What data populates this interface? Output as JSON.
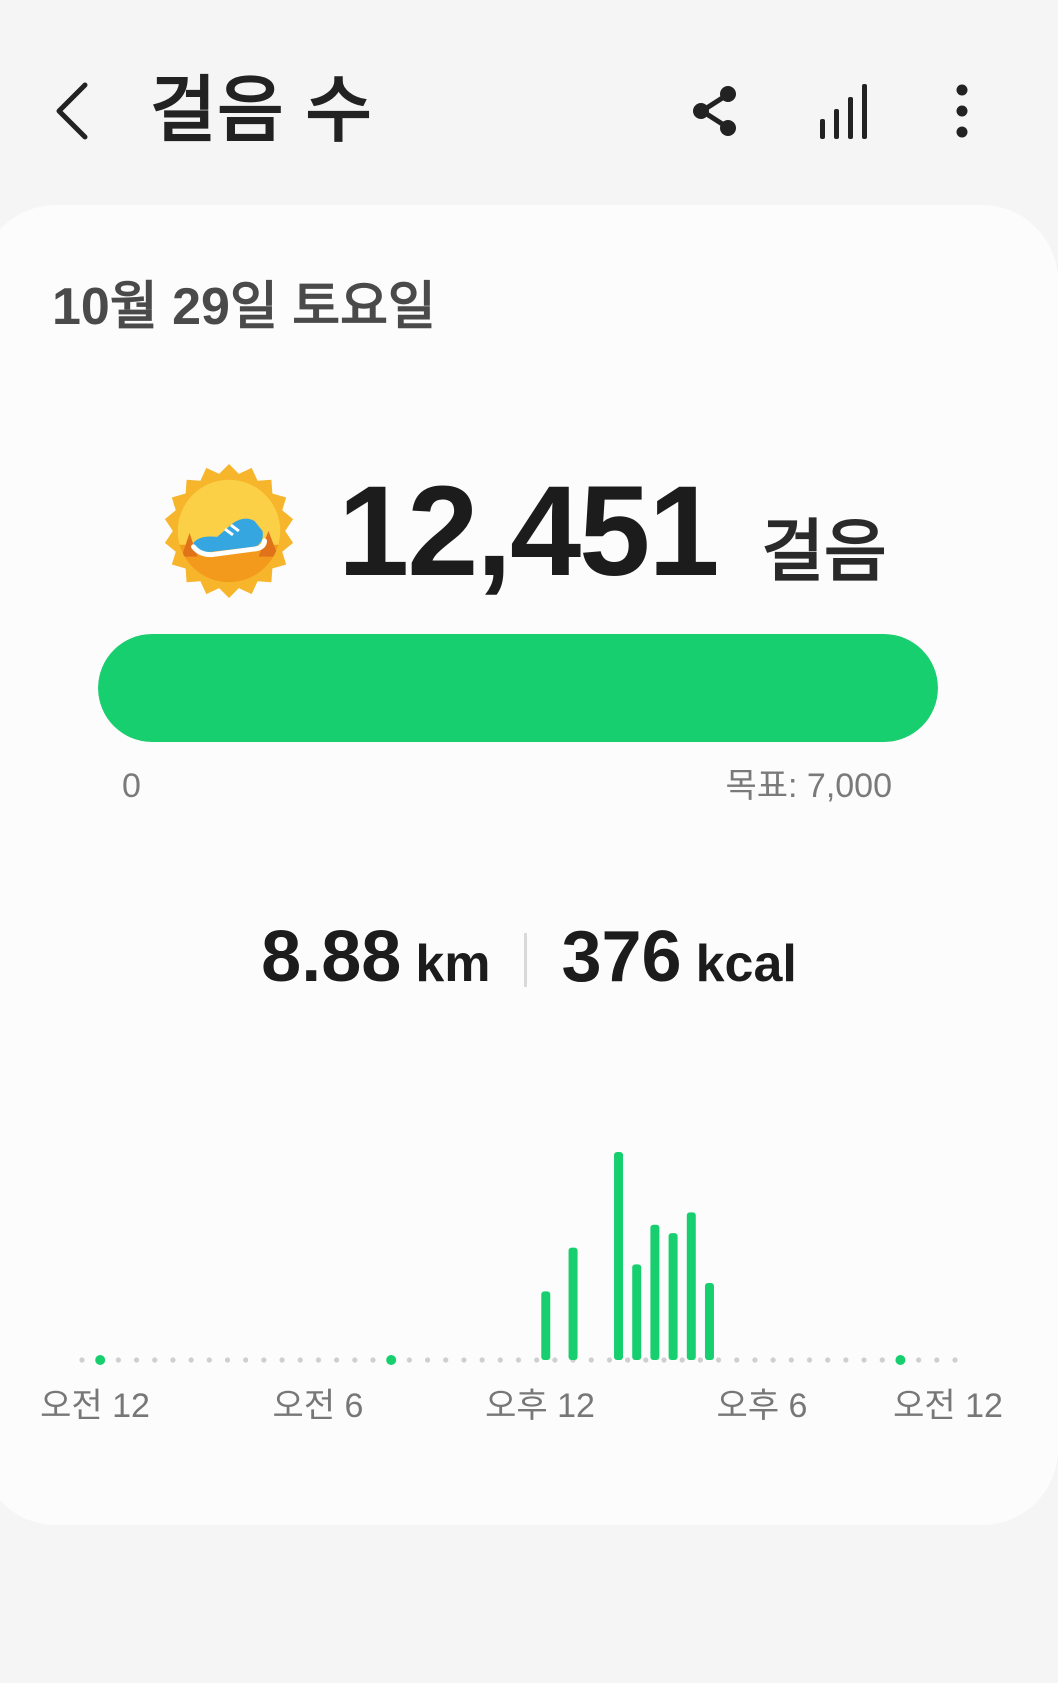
{
  "app_bar": {
    "title": "걸음 수",
    "back_icon": "chevron-left-icon",
    "share_icon": "share-icon",
    "chart_icon": "bar-chart-icon",
    "more_icon": "more-vertical-icon"
  },
  "summary": {
    "date": "10월 29일 토요일",
    "badge_icon": "running-shoe-badge-icon",
    "steps": "12,451",
    "steps_unit": "걸음",
    "progress_fraction": 1.0,
    "progress_min_label": "0",
    "progress_goal_label": "목표: 7,000",
    "distance_value": "8.88",
    "distance_unit": "km",
    "calories_value": "376",
    "calories_unit": "kcal"
  },
  "colors": {
    "accent": "#17cf6e",
    "background": "#f5f5f5",
    "card": "#fcfcfc"
  },
  "chart_data": {
    "type": "bar",
    "x_tick_labels": [
      "오전 12",
      "오전 6",
      "오후 12",
      "오후 6",
      "오전 12"
    ],
    "series": [
      {
        "hours": [
          0.5,
          8.5,
          12.75,
          13.5,
          14.75,
          15.25,
          15.75,
          16.25,
          16.75,
          17.25,
          22.5
        ],
        "values": [
          0,
          0,
          0.33,
          0.54,
          1.0,
          0.46,
          0.65,
          0.61,
          0.71,
          0.37,
          0
        ],
        "is_dot": [
          true,
          true,
          false,
          false,
          false,
          false,
          false,
          false,
          false,
          false,
          true
        ]
      }
    ],
    "grid": false
  }
}
